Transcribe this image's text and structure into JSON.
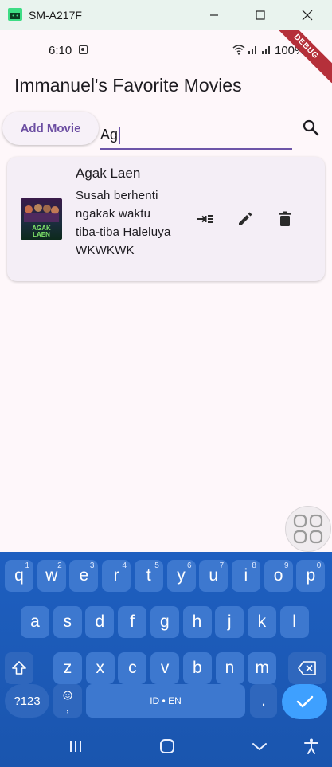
{
  "window": {
    "title": "SM-A217F",
    "app_icon": "android-icon",
    "controls": [
      "minimize-icon",
      "maximize-icon",
      "close-icon"
    ]
  },
  "status_bar": {
    "time": "6:10",
    "battery": "100%",
    "icons": [
      "screen-record-icon",
      "wifi-icon",
      "signal-icon",
      "battery-icon"
    ]
  },
  "debug_banner": "DEBUG",
  "app": {
    "title": "Immanuel's Favorite Movies",
    "add_button": "Add Movie"
  },
  "search": {
    "value": "Ag",
    "placeholder": ""
  },
  "movies": [
    {
      "title": "Agak Laen",
      "description": "Susah berhenti ngakak waktu tiba-tiba Haleluya WKWKWK",
      "poster_text": "AGAK LAEN",
      "actions": [
        "move-to-icon",
        "edit-icon",
        "delete-icon"
      ]
    }
  ],
  "keyboard": {
    "row1": [
      {
        "k": "q",
        "s": "1"
      },
      {
        "k": "w",
        "s": "2"
      },
      {
        "k": "e",
        "s": "3"
      },
      {
        "k": "r",
        "s": "4"
      },
      {
        "k": "t",
        "s": "5"
      },
      {
        "k": "y",
        "s": "6"
      },
      {
        "k": "u",
        "s": "7"
      },
      {
        "k": "i",
        "s": "8"
      },
      {
        "k": "o",
        "s": "9"
      },
      {
        "k": "p",
        "s": "0"
      }
    ],
    "row2": [
      "a",
      "s",
      "d",
      "f",
      "g",
      "h",
      "j",
      "k",
      "l"
    ],
    "row3": [
      "z",
      "x",
      "c",
      "v",
      "b",
      "n",
      "m"
    ],
    "symbols_key": "?123",
    "comma_key": ",",
    "space_label": "ID • EN",
    "period_key": ".",
    "colors": {
      "background": "#1e5fc0",
      "key": "#3d78cf",
      "enter": "#3ea0ff"
    }
  },
  "nav_bar": [
    "recents-icon",
    "home-icon",
    "back-icon",
    "accessibility-icon"
  ],
  "colors": {
    "accent": "#6d55a8",
    "card": "#f4eef6",
    "screen": "#fef7fa",
    "debug": "#b5303a"
  }
}
